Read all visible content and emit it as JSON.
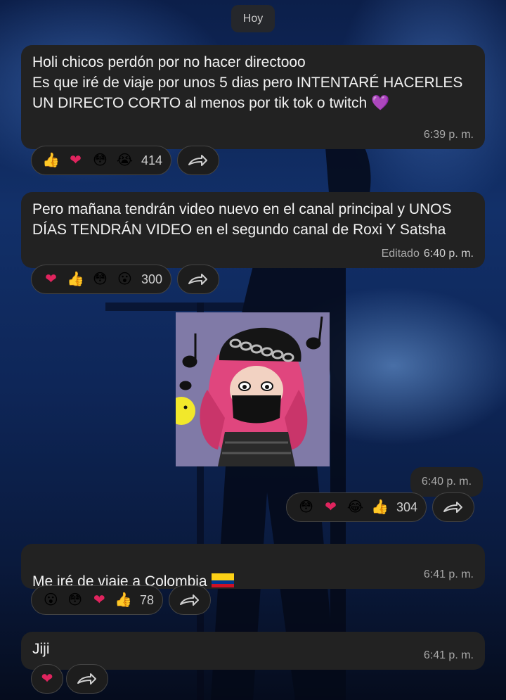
{
  "date_chip": "Hoy",
  "messages": [
    {
      "text": "Holi chicos perdón por no hacer directooo\nEs que iré de viaje por unos 5 dias pero INTENTARÉ HACERLES UN DIRECTO CORTO al menos por tik tok o twitch 💜",
      "time": "6:39 p. m.",
      "edited": "",
      "reactions": [
        "👍",
        "❤",
        "😳",
        "😭"
      ],
      "count": "414"
    },
    {
      "text": "Pero mañana tendrán video nuevo en el canal principal y UNOS DÍAS TENDRÁN VIDEO en el segundo canal de Roxi Y Satsha",
      "time": "6:40 p. m.",
      "edited": "Editado",
      "reactions": [
        "❤",
        "👍",
        "😳",
        "😮"
      ],
      "count": "300"
    },
    {
      "type": "sticker",
      "time": "6:40 p. m.",
      "reactions": [
        "😳",
        "❤",
        "😂",
        "👍"
      ],
      "count": "304"
    },
    {
      "text": "Me iré de viaje a Colombia",
      "time": "6:41 p. m.",
      "reactions": [
        "😮",
        "😳",
        "❤",
        "👍"
      ],
      "count": "78"
    },
    {
      "text": "Jiji",
      "time": "6:41 p. m.",
      "reactions": [
        "❤"
      ],
      "count": ""
    }
  ],
  "icons": {
    "share": "share-arrow-icon",
    "flag": "colombia-flag-icon"
  },
  "colors": {
    "bubble": "#222222",
    "heart": "#e0245e",
    "sticker_bg": "#807aa7"
  }
}
